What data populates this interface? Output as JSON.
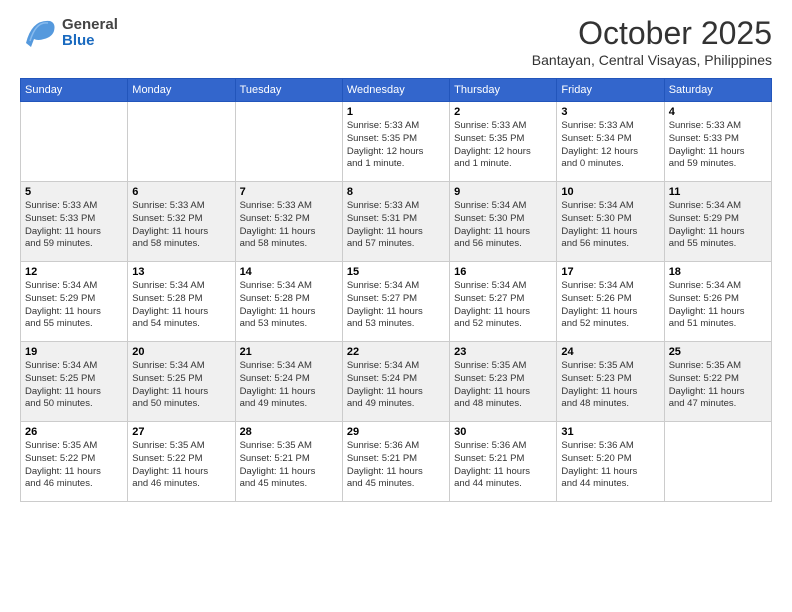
{
  "header": {
    "logo": {
      "line1": "General",
      "line2": "Blue"
    },
    "title": "October 2025",
    "location": "Bantayan, Central Visayas, Philippines"
  },
  "weekdays": [
    "Sunday",
    "Monday",
    "Tuesday",
    "Wednesday",
    "Thursday",
    "Friday",
    "Saturday"
  ],
  "weeks": [
    [
      {
        "day": "",
        "info": ""
      },
      {
        "day": "",
        "info": ""
      },
      {
        "day": "",
        "info": ""
      },
      {
        "day": "1",
        "info": "Sunrise: 5:33 AM\nSunset: 5:35 PM\nDaylight: 12 hours\nand 1 minute."
      },
      {
        "day": "2",
        "info": "Sunrise: 5:33 AM\nSunset: 5:35 PM\nDaylight: 12 hours\nand 1 minute."
      },
      {
        "day": "3",
        "info": "Sunrise: 5:33 AM\nSunset: 5:34 PM\nDaylight: 12 hours\nand 0 minutes."
      },
      {
        "day": "4",
        "info": "Sunrise: 5:33 AM\nSunset: 5:33 PM\nDaylight: 11 hours\nand 59 minutes."
      }
    ],
    [
      {
        "day": "5",
        "info": "Sunrise: 5:33 AM\nSunset: 5:33 PM\nDaylight: 11 hours\nand 59 minutes."
      },
      {
        "day": "6",
        "info": "Sunrise: 5:33 AM\nSunset: 5:32 PM\nDaylight: 11 hours\nand 58 minutes."
      },
      {
        "day": "7",
        "info": "Sunrise: 5:33 AM\nSunset: 5:32 PM\nDaylight: 11 hours\nand 58 minutes."
      },
      {
        "day": "8",
        "info": "Sunrise: 5:33 AM\nSunset: 5:31 PM\nDaylight: 11 hours\nand 57 minutes."
      },
      {
        "day": "9",
        "info": "Sunrise: 5:34 AM\nSunset: 5:30 PM\nDaylight: 11 hours\nand 56 minutes."
      },
      {
        "day": "10",
        "info": "Sunrise: 5:34 AM\nSunset: 5:30 PM\nDaylight: 11 hours\nand 56 minutes."
      },
      {
        "day": "11",
        "info": "Sunrise: 5:34 AM\nSunset: 5:29 PM\nDaylight: 11 hours\nand 55 minutes."
      }
    ],
    [
      {
        "day": "12",
        "info": "Sunrise: 5:34 AM\nSunset: 5:29 PM\nDaylight: 11 hours\nand 55 minutes."
      },
      {
        "day": "13",
        "info": "Sunrise: 5:34 AM\nSunset: 5:28 PM\nDaylight: 11 hours\nand 54 minutes."
      },
      {
        "day": "14",
        "info": "Sunrise: 5:34 AM\nSunset: 5:28 PM\nDaylight: 11 hours\nand 53 minutes."
      },
      {
        "day": "15",
        "info": "Sunrise: 5:34 AM\nSunset: 5:27 PM\nDaylight: 11 hours\nand 53 minutes."
      },
      {
        "day": "16",
        "info": "Sunrise: 5:34 AM\nSunset: 5:27 PM\nDaylight: 11 hours\nand 52 minutes."
      },
      {
        "day": "17",
        "info": "Sunrise: 5:34 AM\nSunset: 5:26 PM\nDaylight: 11 hours\nand 52 minutes."
      },
      {
        "day": "18",
        "info": "Sunrise: 5:34 AM\nSunset: 5:26 PM\nDaylight: 11 hours\nand 51 minutes."
      }
    ],
    [
      {
        "day": "19",
        "info": "Sunrise: 5:34 AM\nSunset: 5:25 PM\nDaylight: 11 hours\nand 50 minutes."
      },
      {
        "day": "20",
        "info": "Sunrise: 5:34 AM\nSunset: 5:25 PM\nDaylight: 11 hours\nand 50 minutes."
      },
      {
        "day": "21",
        "info": "Sunrise: 5:34 AM\nSunset: 5:24 PM\nDaylight: 11 hours\nand 49 minutes."
      },
      {
        "day": "22",
        "info": "Sunrise: 5:34 AM\nSunset: 5:24 PM\nDaylight: 11 hours\nand 49 minutes."
      },
      {
        "day": "23",
        "info": "Sunrise: 5:35 AM\nSunset: 5:23 PM\nDaylight: 11 hours\nand 48 minutes."
      },
      {
        "day": "24",
        "info": "Sunrise: 5:35 AM\nSunset: 5:23 PM\nDaylight: 11 hours\nand 48 minutes."
      },
      {
        "day": "25",
        "info": "Sunrise: 5:35 AM\nSunset: 5:22 PM\nDaylight: 11 hours\nand 47 minutes."
      }
    ],
    [
      {
        "day": "26",
        "info": "Sunrise: 5:35 AM\nSunset: 5:22 PM\nDaylight: 11 hours\nand 46 minutes."
      },
      {
        "day": "27",
        "info": "Sunrise: 5:35 AM\nSunset: 5:22 PM\nDaylight: 11 hours\nand 46 minutes."
      },
      {
        "day": "28",
        "info": "Sunrise: 5:35 AM\nSunset: 5:21 PM\nDaylight: 11 hours\nand 45 minutes."
      },
      {
        "day": "29",
        "info": "Sunrise: 5:36 AM\nSunset: 5:21 PM\nDaylight: 11 hours\nand 45 minutes."
      },
      {
        "day": "30",
        "info": "Sunrise: 5:36 AM\nSunset: 5:21 PM\nDaylight: 11 hours\nand 44 minutes."
      },
      {
        "day": "31",
        "info": "Sunrise: 5:36 AM\nSunset: 5:20 PM\nDaylight: 11 hours\nand 44 minutes."
      },
      {
        "day": "",
        "info": ""
      }
    ]
  ]
}
